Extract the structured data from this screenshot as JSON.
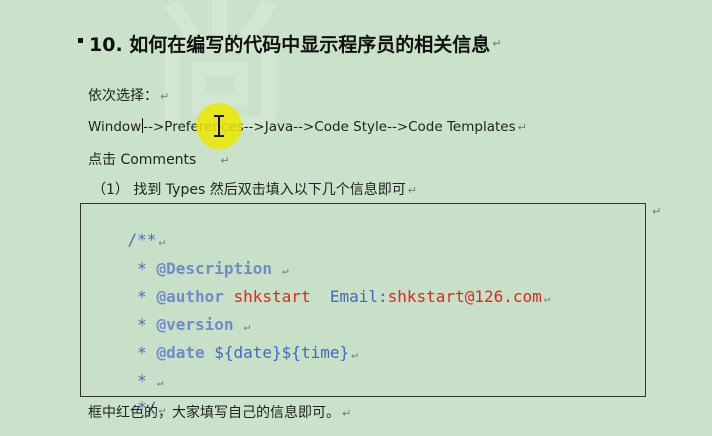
{
  "heading": {
    "title": "10. 如何在编写的代码中显示程序员的相关信息"
  },
  "watermark": {
    "text": "尚"
  },
  "paragraphs": {
    "select": "依次选择：",
    "path_before": "Window",
    "path_after": "-->Preferences-->Java-->Code Style-->Code Templates",
    "click": "点击 Comments",
    "step": "（1） 找到 Types 然后双击填入以下几个信息即可",
    "footer": "框中红色的，大家填写自己的信息即可。"
  },
  "paragraph_mark": "↵",
  "code": {
    "line1": "/**",
    "line2_prefix": " * ",
    "line2_tag": "@Description",
    "line3_prefix": " * ",
    "line3_tag": "@author",
    "line3_value": " shkstart",
    "line3_label": "  Email:",
    "line3_email": "shkstart@126.com",
    "line4_prefix": " * ",
    "line4_tag": "@version",
    "line5_prefix": " * ",
    "line5_tag": "@date",
    "line5_value": " ${date}${time}",
    "line6": " *",
    "line7": " */"
  }
}
